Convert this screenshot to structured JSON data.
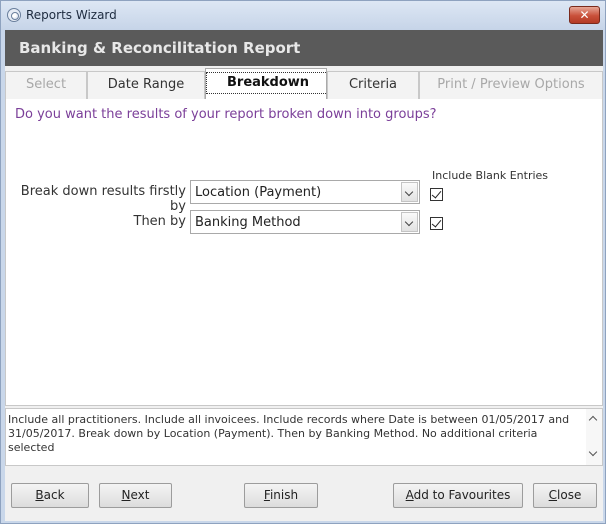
{
  "window": {
    "title": "Reports Wizard",
    "close_glyph": "✕"
  },
  "header": {
    "title": "Banking & Reconcilitation Report"
  },
  "tabs": [
    {
      "label": "Select",
      "state": "disabled"
    },
    {
      "label": "Date Range",
      "state": "enabled"
    },
    {
      "label": "Breakdown",
      "state": "active"
    },
    {
      "label": "Criteria",
      "state": "enabled"
    },
    {
      "label": "Print / Preview Options",
      "state": "disabled"
    }
  ],
  "breakdown": {
    "question": "Do you want the results of your report broken down into groups?",
    "include_blank_header": "Include Blank Entries",
    "rows": [
      {
        "label": "Break down results firstly by",
        "value": "Location (Payment)",
        "include_blank": true
      },
      {
        "label": "Then by",
        "value": "Banking Method",
        "include_blank": true
      }
    ]
  },
  "summary": {
    "text": "Include all practitioners. Include all invoicees. Include records where Date is between 01/05/2017 and 31/05/2017. Break down by Location (Payment). Then by Banking Method. No additional criteria selected"
  },
  "buttons": {
    "back": {
      "label": "Back",
      "accel": "B"
    },
    "next": {
      "label": "Next",
      "accel": "N"
    },
    "finish": {
      "label": "Finish",
      "accel": "F"
    },
    "add_fav": {
      "label": "Add to Favourites",
      "accel": "A"
    },
    "close": {
      "label": "Close",
      "accel": "C"
    }
  }
}
